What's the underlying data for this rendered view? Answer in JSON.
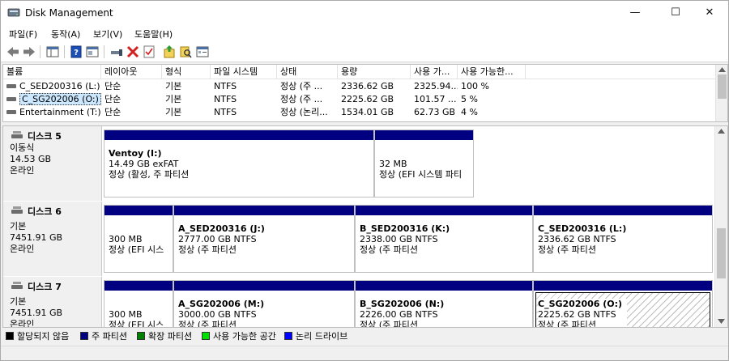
{
  "window": {
    "title": "Disk Management"
  },
  "title_controls": {
    "minimize": "—",
    "maximize": "☐",
    "close": "✕"
  },
  "menu": [
    {
      "label": "파일(F)"
    },
    {
      "label": "동작(A)"
    },
    {
      "label": "보기(V)"
    },
    {
      "label": "도움말(H)"
    }
  ],
  "toolbar": {
    "icons": [
      "back-arrow-icon",
      "forward-arrow-icon",
      "console-tree-icon",
      "help-icon",
      "properties-icon",
      "connect-icon",
      "delete-icon",
      "check-icon",
      "export-icon",
      "search-icon",
      "console-icon"
    ],
    "colors": {
      "back_forward": "#6a6a6a",
      "delete": "#d32020",
      "help": "#1b4fb5"
    }
  },
  "volume_list": {
    "columns": [
      "볼륨",
      "레이아웃",
      "형식",
      "파일 시스템",
      "상태",
      "용량",
      "사용 가...",
      "사용 가능한..."
    ],
    "rows": [
      {
        "name": "C_SED200316 (L:)",
        "layout": "단순",
        "type": "기본",
        "fs": "NTFS",
        "status": "정상 (주 ...",
        "capacity": "2336.62 GB",
        "free": "2325.94...",
        "percent": "100 %",
        "selected": false
      },
      {
        "name": "C_SG202006 (O:)",
        "layout": "단순",
        "type": "기본",
        "fs": "NTFS",
        "status": "정상 (주 ...",
        "capacity": "2225.62 GB",
        "free": "101.57 ...",
        "percent": "5 %",
        "selected": true
      },
      {
        "name": "Entertainment (T:)",
        "layout": "단순",
        "type": "기본",
        "fs": "NTFS",
        "status": "정상 (논리...",
        "capacity": "1534.01 GB",
        "free": "62.73 GB",
        "percent": "4 %",
        "selected": false
      }
    ]
  },
  "disks": [
    {
      "name": "디스크 5",
      "kind": "이동식",
      "size": "14.53 GB",
      "state": "온라인",
      "partitions": [
        {
          "title": "Ventoy (I:)",
          "line1": "14.49 GB exFAT",
          "line2": "정상 (활성, 주 파티션",
          "selected": false
        },
        {
          "title": "",
          "line1": "32 MB",
          "line2": "정상 (EFI 시스템 파티",
          "selected": false
        }
      ]
    },
    {
      "name": "디스크 6",
      "kind": "기본",
      "size": "7451.91 GB",
      "state": "온라인",
      "partitions": [
        {
          "title": "",
          "line1": "300 MB",
          "line2": "정상 (EFI 시스",
          "selected": false
        },
        {
          "title": "A_SED200316 (J:)",
          "line1": "2777.00 GB NTFS",
          "line2": "정상 (주 파티션",
          "selected": false
        },
        {
          "title": "B_SED200316 (K:)",
          "line1": "2338.00 GB NTFS",
          "line2": "정상 (주 파티션",
          "selected": false
        },
        {
          "title": "C_SED200316 (L:)",
          "line1": "2336.62 GB NTFS",
          "line2": "정상 (주 파티션",
          "selected": false
        }
      ]
    },
    {
      "name": "디스크 7",
      "kind": "기본",
      "size": "7451.91 GB",
      "state": "온라인",
      "partitions": [
        {
          "title": "",
          "line1": "300 MB",
          "line2": "정상 (EFI 시스",
          "selected": false
        },
        {
          "title": "A_SG202006 (M:)",
          "line1": "3000.00 GB NTFS",
          "line2": "정상 (주 파티션",
          "selected": false
        },
        {
          "title": "B_SG202006 (N:)",
          "line1": "2226.00 GB NTFS",
          "line2": "정상 (주 파티션",
          "selected": false
        },
        {
          "title": "C_SG202006 (O:)",
          "line1": "2225.62 GB NTFS",
          "line2": "정상 (주 파티션",
          "selected": true
        }
      ]
    }
  ],
  "legend": [
    {
      "label": "할당되지 않음",
      "color": "#000000"
    },
    {
      "label": "주 파티션",
      "color": "#000080"
    },
    {
      "label": "확장 파티션",
      "color": "#008000"
    },
    {
      "label": "사용 가능한 공간",
      "color": "#00e000"
    },
    {
      "label": "논리 드라이브",
      "color": "#0000ff"
    }
  ]
}
